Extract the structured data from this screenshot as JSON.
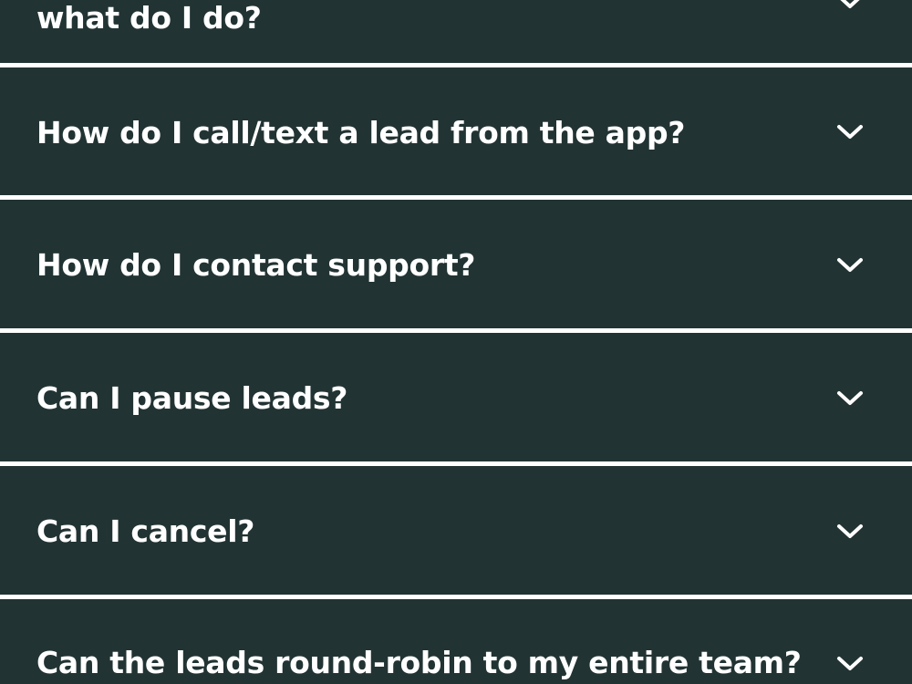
{
  "faq": {
    "items": [
      {
        "question": "what do I do?",
        "icon": "chevron-down-icon"
      },
      {
        "question": "How do I call/text a lead from the app?",
        "icon": "chevron-down-icon"
      },
      {
        "question": "How do I contact support?",
        "icon": "chevron-down-icon"
      },
      {
        "question": "Can I pause leads?",
        "icon": "chevron-down-icon"
      },
      {
        "question": "Can I cancel?",
        "icon": "chevron-down-icon"
      },
      {
        "question": "Can the leads round-robin to my entire team?",
        "icon": "chevron-down-icon"
      }
    ]
  },
  "colors": {
    "panel": "#223333",
    "divider": "#ffffff",
    "text": "#ffffff"
  }
}
